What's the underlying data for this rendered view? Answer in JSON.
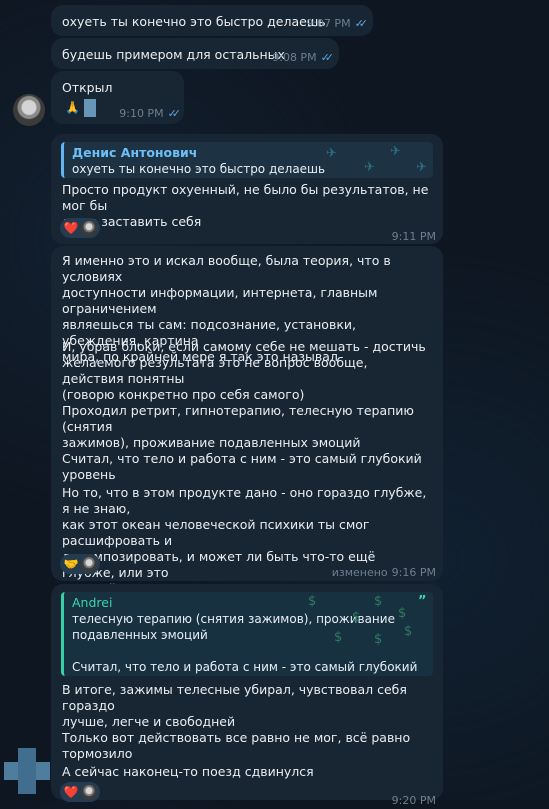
{
  "messages": {
    "m1": {
      "text": "охуеть ты конечно это быстро делаешь",
      "time": "9:07 PM"
    },
    "m2": {
      "text": "будешь примером для остальных",
      "time": "9:08 PM"
    },
    "m3": {
      "text": "Открыл",
      "emoji": "🙏",
      "time": "9:10 PM"
    },
    "m4": {
      "reply_name": "Денис Антонович",
      "reply_text": "охуеть ты конечно это быстро делаешь",
      "text": "Просто продукт охуенный, не было бы результатов, не мог бы\nдаже заставить себя",
      "reaction": "❤️",
      "time": "9:11 PM"
    },
    "m5": {
      "p1": "Я именно это и искал вообще, была теория, что в условиях\nдоступности информации, интернета, главным ограничением\nявляешься ты сам: подсознание, установки, убеждения, картина\nмира, по крайней мере я так это называл",
      "p2": "И, убрав блоки, если самому себе не мешать - достичь\nжелаемого результата это не вопрос вообще, действия понятны\n(говорю конкретно про себя самого)",
      "p3": "Проходил ретрит, гипнотерапию, телесную терапию (снятия\nзажимов), проживание подавленных эмоций",
      "p4": "Считал, что тело и работа с ним - это самый глубокий уровень",
      "p5": "Но то, что в этом продукте дано - оно гораздо глубже, я не знаю,\nкак этот океан человеческой психики ты смог расшифровать и\nдекомпозировать, и может ли быть что-то ещё глубже, или это\nнулевой этаж",
      "reaction": "🤝",
      "edited": "изменено",
      "time": "9:16 PM"
    },
    "m6": {
      "reply_name": "Andrei",
      "reply_text": "телесную терапию (снятия зажимов), проживание\nподавленных эмоций\n\nСчитал, что тело и работа с ним - это самый глубокий уровень",
      "p1": "В итоге, зажимы телесные убирал, чувствовал себя гораздо\nлучше, легче и свободней",
      "p2": "Только вот действовать все равно не мог, всё равно тормозило",
      "p3": "А сейчас наконец-то поезд сдвинулся",
      "reaction": "❤️",
      "time": "9:20 PM"
    }
  },
  "icons": {
    "double_check": "double-check-icon",
    "reply_pattern": "telegram-pattern-icon",
    "money_pattern": "money-bag-pattern-icon",
    "quote": "quote-icon"
  },
  "colors": {
    "background": "#0e1621",
    "bubble": "#182533",
    "link_name": "#6cc0f7",
    "andrei_name": "#3bd3ae",
    "meta": "#6d7f8f",
    "check": "#5aa6e4"
  }
}
